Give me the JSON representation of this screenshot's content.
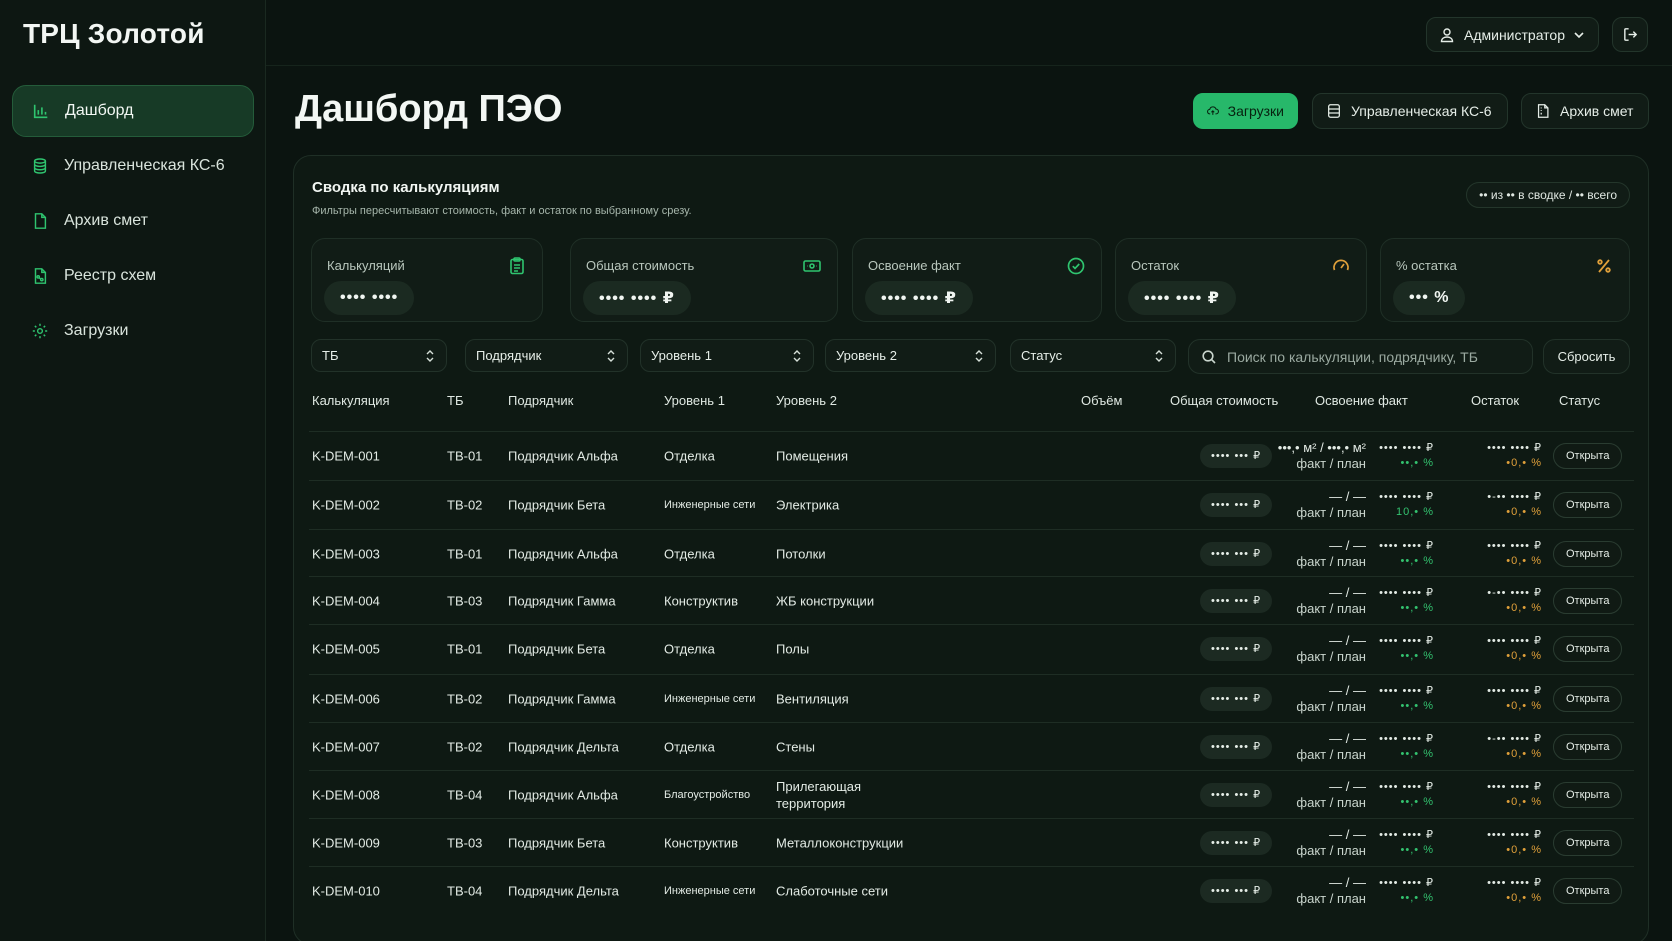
{
  "brand": "ТРЦ Золотой",
  "sidebar": {
    "items": [
      {
        "label": "Дашборд",
        "icon": "bar-chart-icon",
        "active": true
      },
      {
        "label": "Управленческая КС-6",
        "icon": "database-icon"
      },
      {
        "label": "Архив смет",
        "icon": "file-icon"
      },
      {
        "label": "Реестр схем",
        "icon": "file-scheme-icon"
      },
      {
        "label": "Загрузки",
        "icon": "gear-icon"
      }
    ]
  },
  "topbar": {
    "user_label": "Администратор"
  },
  "page": {
    "title": "Дашборд ПЭО"
  },
  "header_buttons": {
    "uploads": "Загрузки",
    "ks6": "Управленческая КС-6",
    "archive": "Архив смет"
  },
  "summary": {
    "title": "Сводка по калькуляциям",
    "subtitle": "Фильтры пересчитывают стоимость, факт и остаток по выбранному срезу.",
    "count_pill": "•• из •• в сводке / •• всего"
  },
  "kpis": [
    {
      "label": "Калькуляций",
      "value": "•••• ••••",
      "icon": "clipboard-icon"
    },
    {
      "label": "Общая стоимость",
      "value": "•••• •••• ₽",
      "icon": "banknote-icon"
    },
    {
      "label": "Освоение факт",
      "value": "•••• •••• ₽",
      "icon": "check-circle-icon"
    },
    {
      "label": "Остаток",
      "value": "•••• •••• ₽",
      "icon": "gauge-icon"
    },
    {
      "label": "% остатка",
      "value": "••• %",
      "icon": "percent-icon"
    }
  ],
  "filters": {
    "tb": "ТБ",
    "contractor": "Подрядчик",
    "level1": "Уровень 1",
    "level2": "Уровень 2",
    "status": "Статус",
    "search_placeholder": "Поиск по калькуляции, подрядчику, ТБ",
    "reset": "Сбросить"
  },
  "table": {
    "headers": [
      "Калькуляция",
      "ТБ",
      "Подрядчик",
      "Уровень 1",
      "Уровень 2",
      "Объём",
      "Общая стоимость",
      "Освоение факт",
      "Остаток",
      "Статус"
    ],
    "rows": [
      {
        "id": "K-DEM-001",
        "tb": "TB-01",
        "contractor": "Подрядчик Альфа",
        "level1": "Отделка",
        "level2": "Помещения",
        "volume": "•••,• м² / •••,• м²",
        "volume_sub": "факт / план",
        "cost": "•••• ••• ₽",
        "fact": "•••• •••• ₽",
        "fact_pct": "••,• %",
        "rest": "•••• •••• ₽",
        "rest_pct": "•0,• %",
        "status": "Открыта"
      },
      {
        "id": "K-DEM-002",
        "tb": "TB-02",
        "contractor": "Подрядчик Бета",
        "level1": "Инженерные сети",
        "level2": "Электрика",
        "volume": "— / —",
        "volume_sub": "факт / план",
        "cost": "•••• ••• ₽",
        "fact": "•••• •••• ₽",
        "fact_pct": "10,• %",
        "rest": "•-•• •••• ₽",
        "rest_pct": "•0,• %",
        "status": "Открыта"
      },
      {
        "id": "K-DEM-003",
        "tb": "TB-01",
        "contractor": "Подрядчик Альфа",
        "level1": "Отделка",
        "level2": "Потолки",
        "volume": "— / —",
        "volume_sub": "факт / план",
        "cost": "•••• ••• ₽",
        "fact": "•••• •••• ₽",
        "fact_pct": "••,• %",
        "rest": "•••• •••• ₽",
        "rest_pct": "•0,• %",
        "status": "Открыта"
      },
      {
        "id": "K-DEM-004",
        "tb": "TB-03",
        "contractor": "Подрядчик Гамма",
        "level1": "Конструктив",
        "level2": "ЖБ конструкции",
        "volume": "— / —",
        "volume_sub": "факт / план",
        "cost": "•••• ••• ₽",
        "fact": "•••• •••• ₽",
        "fact_pct": "••,• %",
        "rest": "•-•• •••• ₽",
        "rest_pct": "•0,• %",
        "status": "Открыта"
      },
      {
        "id": "K-DEM-005",
        "tb": "TB-01",
        "contractor": "Подрядчик Бета",
        "level1": "Отделка",
        "level2": "Полы",
        "volume": "— / —",
        "volume_sub": "факт / план",
        "cost": "•••• ••• ₽",
        "fact": "•••• •••• ₽",
        "fact_pct": "••,• %",
        "rest": "•••• •••• ₽",
        "rest_pct": "•0,• %",
        "status": "Открыта"
      },
      {
        "id": "K-DEM-006",
        "tb": "TB-02",
        "contractor": "Подрядчик Гамма",
        "level1": "Инженерные сети",
        "level2": "Вентиляция",
        "volume": "— / —",
        "volume_sub": "факт / план",
        "cost": "•••• ••• ₽",
        "fact": "•••• •••• ₽",
        "fact_pct": "••,• %",
        "rest": "•••• •••• ₽",
        "rest_pct": "•0,• %",
        "status": "Открыта"
      },
      {
        "id": "K-DEM-007",
        "tb": "TB-02",
        "contractor": "Подрядчик Дельта",
        "level1": "Отделка",
        "level2": "Стены",
        "volume": "— / —",
        "volume_sub": "факт / план",
        "cost": "•••• ••• ₽",
        "fact": "•••• •••• ₽",
        "fact_pct": "••,• %",
        "rest": "•-•• •••• ₽",
        "rest_pct": "•0,• %",
        "status": "Открыта"
      },
      {
        "id": "K-DEM-008",
        "tb": "TB-04",
        "contractor": "Подрядчик Альфа",
        "level1": "Благоустройство",
        "level2": "Прилегающая территория",
        "volume": "— / —",
        "volume_sub": "факт / план",
        "cost": "•••• ••• ₽",
        "fact": "•••• •••• ₽",
        "fact_pct": "••,• %",
        "rest": "•••• •••• ₽",
        "rest_pct": "•0,• %",
        "status": "Открыта"
      },
      {
        "id": "K-DEM-009",
        "tb": "TB-03",
        "contractor": "Подрядчик Бета",
        "level1": "Конструктив",
        "level2": "Металлоконструкции",
        "volume": "— / —",
        "volume_sub": "факт / план",
        "cost": "•••• ••• ₽",
        "fact": "•••• •••• ₽",
        "fact_pct": "••,• %",
        "rest": "•••• •••• ₽",
        "rest_pct": "•0,• %",
        "status": "Открыта"
      },
      {
        "id": "K-DEM-010",
        "tb": "TB-04",
        "contractor": "Подрядчик Дельта",
        "level1": "Инженерные сети",
        "level2": "Слаботочные сети",
        "volume": "— / —",
        "volume_sub": "факт / план",
        "cost": "•••• ••• ₽",
        "fact": "•••• •••• ₽",
        "fact_pct": "••,• %",
        "rest": "•••• •••• ₽",
        "rest_pct": "•0,• %",
        "status": "Открыта"
      }
    ]
  },
  "colors": {
    "accent": "#27b86a",
    "positive": "#33c26f",
    "warning": "#e0a03a",
    "background": "#0b1410"
  }
}
